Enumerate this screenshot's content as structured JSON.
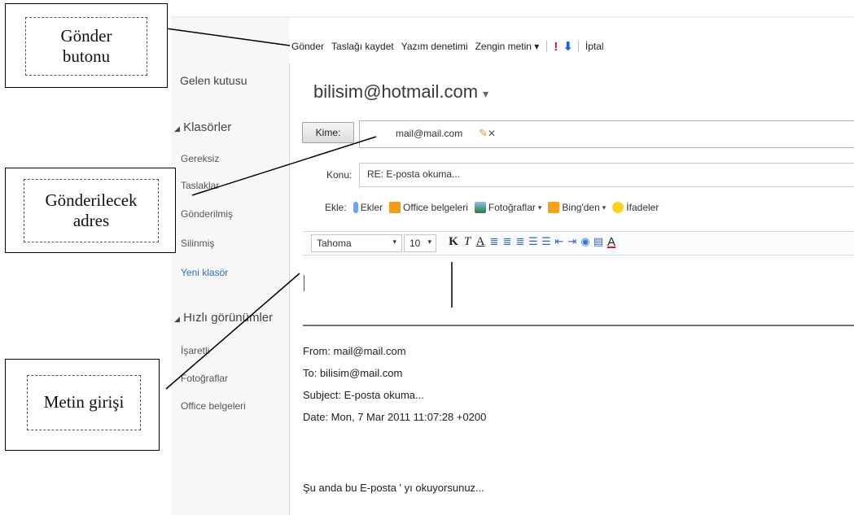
{
  "toolbar": {
    "send": "Gönder",
    "save_draft": "Taslağı kaydet",
    "spell_check": "Yazım denetimi",
    "rich_text": "Zengin metin",
    "rich_text_caret": "▾",
    "high_importance": "!",
    "low_importance": "⬇",
    "cancel": "İptal"
  },
  "sidebar": {
    "inbox": "Gelen kutusu",
    "folders_heading": "Klasörler",
    "folders": [
      "Gereksiz",
      "Taslaklar",
      "Gönderilmiş",
      "Silinmiş"
    ],
    "new_folder": "Yeni klasör",
    "quick_views_heading": "Hızlı görünümler",
    "quick_views": [
      "İşaretli",
      "Fotoğraflar",
      "Office belgeleri"
    ]
  },
  "compose": {
    "from_address": "bilisim@hotmail.com",
    "from_caret": "▾",
    "to_button": "Kime:",
    "recipient": "mail@mail.com",
    "recipient_remove": "✕",
    "subject_label": "Konu:",
    "subject_value": "RE: E-posta okuma...",
    "attach_label": "Ekle:",
    "attach_items": {
      "files": "Ekler",
      "office_docs": "Office belgeleri",
      "photos": "Fotoğraflar",
      "bing": "Bing'den",
      "emoticons": "İfadeler"
    },
    "font_name": "Tahoma",
    "font_size": "10"
  },
  "quoted_message": {
    "from": "From: mail@mail.com",
    "to": "To: bilisim@mail.com",
    "subject": "Subject: E-posta okuma...",
    "date": "Date: Mon, 7 Mar 2011 11:07:28 +0200",
    "body": "Şu anda bu E-posta ' yı okuyorsunuz..."
  },
  "annotations": {
    "send_button_line1": "Gönder",
    "send_button_line2": "butonu",
    "address_line1": "Gönderilecek",
    "address_line2": "adres",
    "text_input": "Metin girişi"
  },
  "colors": {
    "link_blue": "#2b6cd6",
    "importance_red": "#e0102a",
    "sidebar_bg": "#f7f7f7"
  }
}
